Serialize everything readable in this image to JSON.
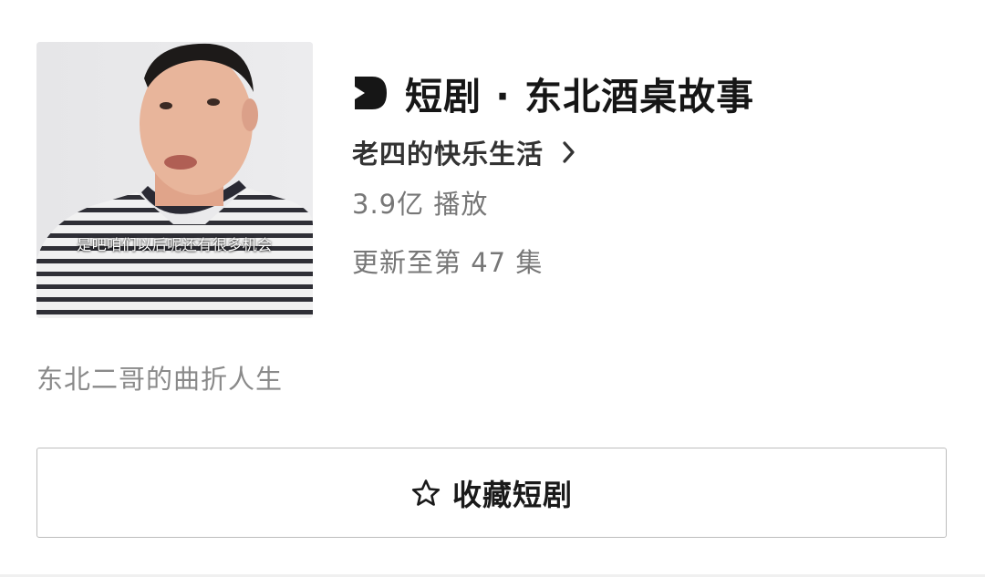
{
  "drama": {
    "thumbnail_caption": "是吧咱们以后呢还有很多机会",
    "title": "短剧 · 东北酒桌故事",
    "author": "老四的快乐生活",
    "play_count": "3.9亿 播放",
    "episode_status": "更新至第 47 集",
    "description": "东北二哥的曲折人生"
  },
  "actions": {
    "collect_label": "收藏短剧"
  },
  "icons": {
    "brand": "short-drama-play-icon",
    "author_link": "chevron-right-icon",
    "collect": "star-outline-icon"
  },
  "colors": {
    "title": "#161616",
    "meta_text": "#777777",
    "description_text": "#8a8a8a",
    "button_border": "#bdbdbd"
  }
}
